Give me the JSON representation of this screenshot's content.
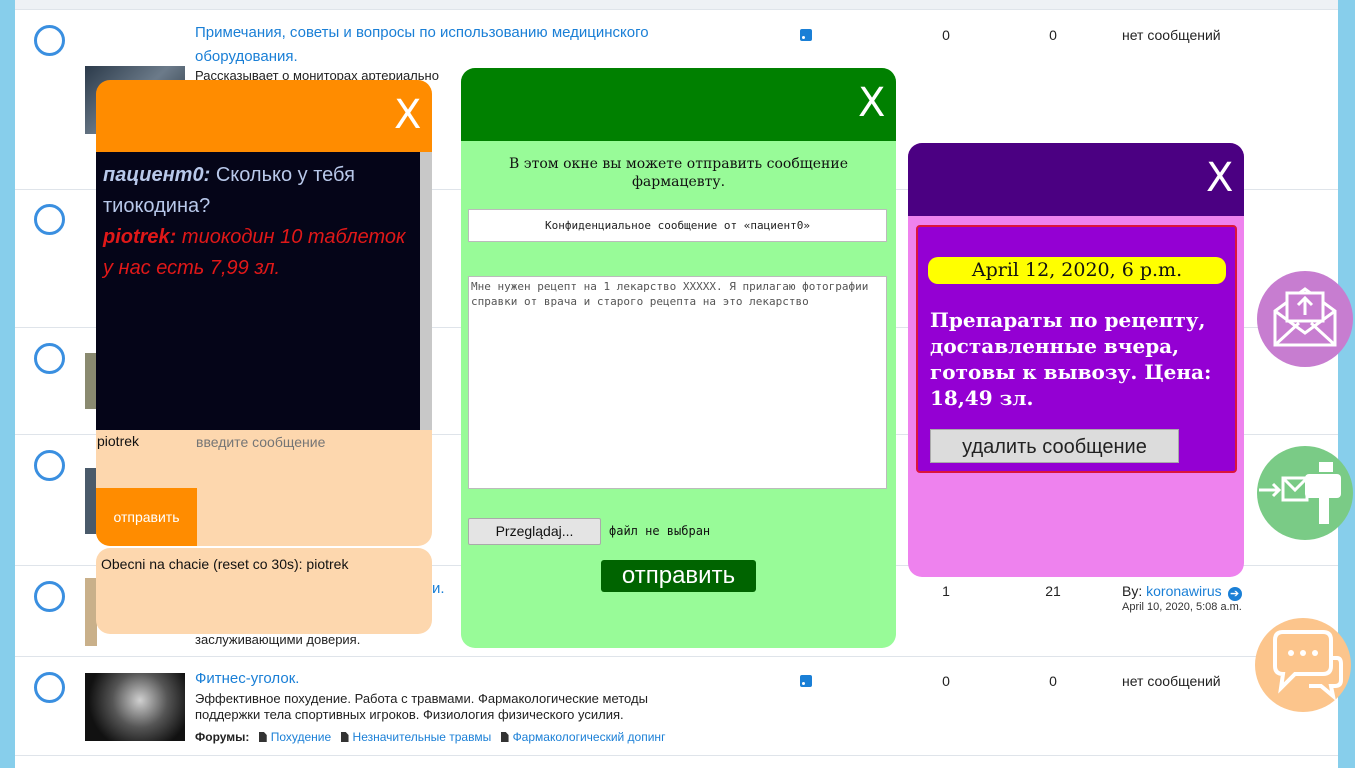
{
  "forum": {
    "rows": [
      {
        "title_line1": "Примечания, советы и вопросы по использованию медицинского",
        "title_line2": "оборудования.",
        "desc_visible": "Рассказывает о мониторах артериально",
        "topics": "0",
        "posts": "0",
        "last": "нет сообщений"
      },
      {
        "topics": "1",
        "posts": "21",
        "last_by_label": "By:",
        "last_by_user": "koronawirus",
        "last_date": "April 10, 2020, 5:08 a.m.",
        "desc_tail": "заслуживающими доверия.",
        "title_tail": "и."
      },
      {
        "title": "Фитнес-уголок.",
        "desc_line1": "Эффективное похудение. Работа с травмами. Фармакологические методы",
        "desc_line2": "поддержки тела спортивных игроков. Физиология физического усилия.",
        "forums_label": "Форумы:",
        "links": [
          "Похудение",
          "Незначительные травмы",
          "Фармакологический допинг"
        ],
        "topics": "0",
        "posts": "0",
        "last": "нет сообщений"
      }
    ]
  },
  "chat": {
    "close": "X",
    "messages": [
      {
        "user": "пациент0:",
        "text": "Сколько у тебя тиокодина?"
      },
      {
        "user": "piotrek:",
        "text": "тиокодин 10 таблеток у нас есть 7,99 зл."
      }
    ],
    "current_user": "piotrek",
    "input_placeholder": "введите сообщение",
    "send": "отправить",
    "online": "Obecni na chacie (reset co 30s): piotrek"
  },
  "pharmacist_form": {
    "close": "X",
    "intro": "В этом окне вы можете отправить сообщение фармацевту.",
    "subject": "Конфиденциальное сообщение от «пациент0»",
    "body": "Мне нужен рецепт на 1 лекарство XXXXX. Я прилагаю фотографии справки от врача и старого рецепта на это лекарство",
    "browse": "Przeglądaj...",
    "no_file": "файл не выбран",
    "send": "отправить"
  },
  "notice": {
    "close": "X",
    "date": "April 12, 2020, 6 p.m.",
    "text": "Препараты по рецепту, доставленные вчера, готовы к вывозу. Цена: 18,49 зл.",
    "delete": "удалить сообщение"
  },
  "side_buttons": [
    {
      "name": "mail-upload",
      "color": "#c77dd0"
    },
    {
      "name": "mailbox-send",
      "color": "#7acb86"
    },
    {
      "name": "chat-bubbles",
      "color": "#fcc58c"
    }
  ]
}
